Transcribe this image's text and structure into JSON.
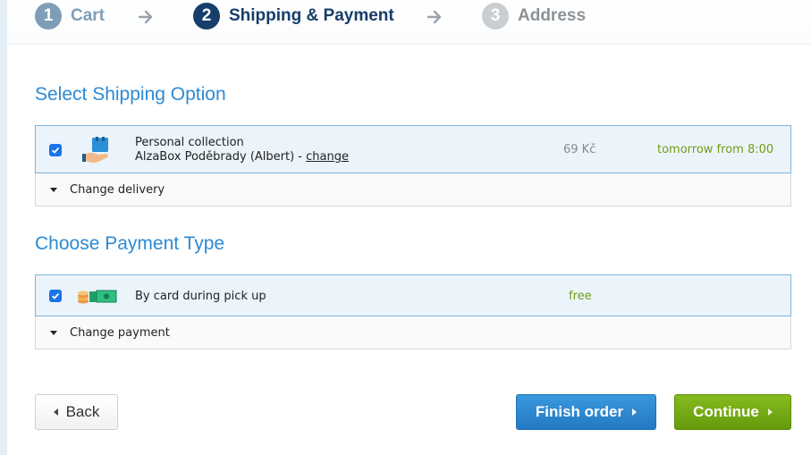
{
  "steps": [
    {
      "num": "1",
      "label": "Cart"
    },
    {
      "num": "2",
      "label": "Shipping & Payment"
    },
    {
      "num": "3",
      "label": "Address"
    }
  ],
  "shipping": {
    "title": "Select Shipping Option",
    "option": {
      "name": "Personal collection",
      "location": "AlzaBox Poděbrady (Albert) - ",
      "change_link": "change",
      "price": "69 Kč",
      "delivery_time": "tomorrow from 8:00",
      "checked": true,
      "icon": "parcel-pickup-icon"
    },
    "toggle_label": "Change delivery"
  },
  "payment": {
    "title": "Choose Payment Type",
    "option": {
      "name": "By card during pick up",
      "price": "free",
      "checked": true,
      "icon": "cash-coins-icon"
    },
    "toggle_label": "Change payment"
  },
  "buttons": {
    "back": "Back",
    "finish": "Finish order",
    "continue": "Continue"
  },
  "colors": {
    "accent_blue": "#2d8ad2",
    "active_step": "#173d6b",
    "green": "#6e9e12"
  }
}
